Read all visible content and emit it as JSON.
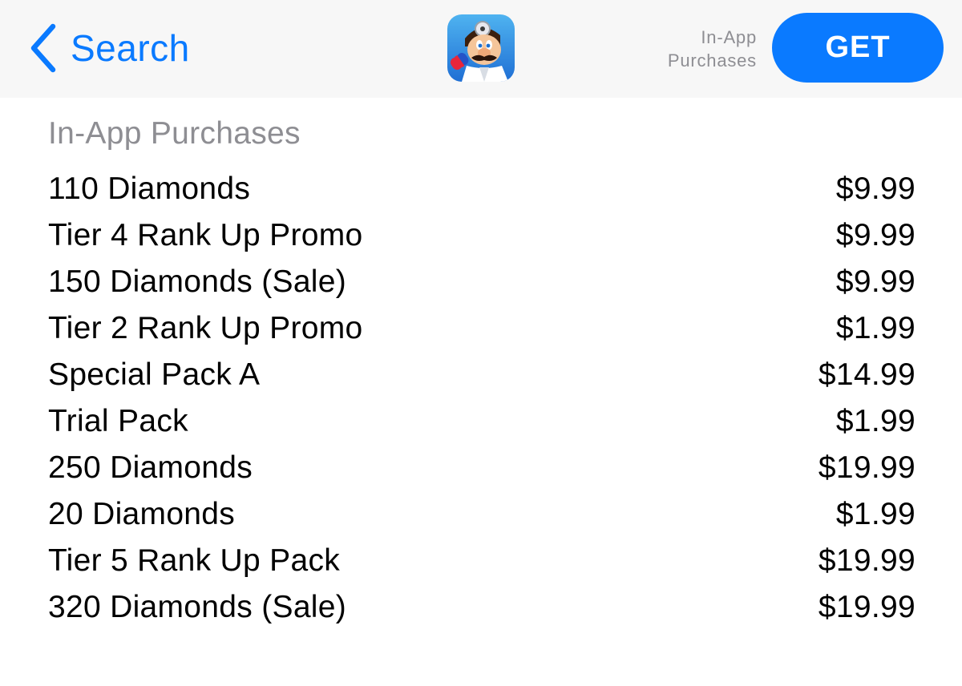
{
  "nav": {
    "back_label": "Search",
    "iap_note_line1": "In-App",
    "iap_note_line2": "Purchases",
    "get_label": "GET"
  },
  "colors": {
    "accent": "#0a7aff",
    "secondary_text": "#8e8e93",
    "nav_background": "#f7f7f7"
  },
  "icons": {
    "back": "chevron-left-icon",
    "app": "dr-mario-app-icon"
  },
  "section": {
    "title": "In-App Purchases"
  },
  "purchases": [
    {
      "name": "110 Diamonds",
      "price": "$9.99"
    },
    {
      "name": "Tier 4 Rank Up Promo",
      "price": "$9.99"
    },
    {
      "name": "150 Diamonds (Sale)",
      "price": "$9.99"
    },
    {
      "name": "Tier 2 Rank Up Promo",
      "price": "$1.99"
    },
    {
      "name": "Special Pack A",
      "price": "$14.99"
    },
    {
      "name": "Trial Pack",
      "price": "$1.99"
    },
    {
      "name": "250 Diamonds",
      "price": "$19.99"
    },
    {
      "name": "20 Diamonds",
      "price": "$1.99"
    },
    {
      "name": "Tier 5 Rank Up Pack",
      "price": "$19.99"
    },
    {
      "name": "320 Diamonds (Sale)",
      "price": "$19.99"
    }
  ]
}
